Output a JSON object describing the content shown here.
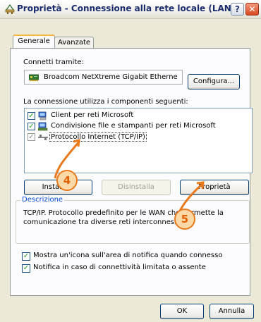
{
  "window": {
    "title": "Proprietà - Connessione alla rete locale (LAN)",
    "help_glyph": "?",
    "close_glyph": "✕"
  },
  "tabs": [
    {
      "label": "Generale",
      "active": true
    },
    {
      "label": "Avanzate",
      "active": false
    }
  ],
  "general": {
    "connect_using_label": "Connetti tramite:",
    "adapter_name": "Broadcom NetXtreme Gigabit Etherne",
    "configure_button": "Configura...",
    "components_label": "La connessione utilizza i componenti seguenti:",
    "components": [
      {
        "label": "Client per reti Microsoft",
        "checked": true,
        "icon": "network-client-icon"
      },
      {
        "label": "Condivisione file e stampanti per reti Microsoft",
        "checked": true,
        "icon": "file-printer-sharing-icon"
      },
      {
        "label": "Protocollo Internet (TCP/IP)",
        "checked": true,
        "icon": "protocol-icon",
        "selected": true
      }
    ],
    "install_button": "Installa...",
    "uninstall_button": "Disinstalla",
    "properties_button": "Proprietà",
    "description_legend": "Descrizione",
    "description_text": "TCP/IP. Protocollo predefinito per le WAN che permette la comunicazione tra diverse reti interconnesse.",
    "show_icon_checkbox": {
      "label": "Mostra un'icona sull'area di notifica quando connesso",
      "checked": true
    },
    "notify_checkbox": {
      "label": "Notifica in caso di connettività limitata o assente",
      "checked": true
    }
  },
  "footer": {
    "ok_button": "OK",
    "cancel_button": "Annulla"
  },
  "annotations": [
    {
      "label": "4",
      "color": "#e97a1b"
    },
    {
      "label": "5",
      "color": "#e97a1b"
    }
  ]
}
